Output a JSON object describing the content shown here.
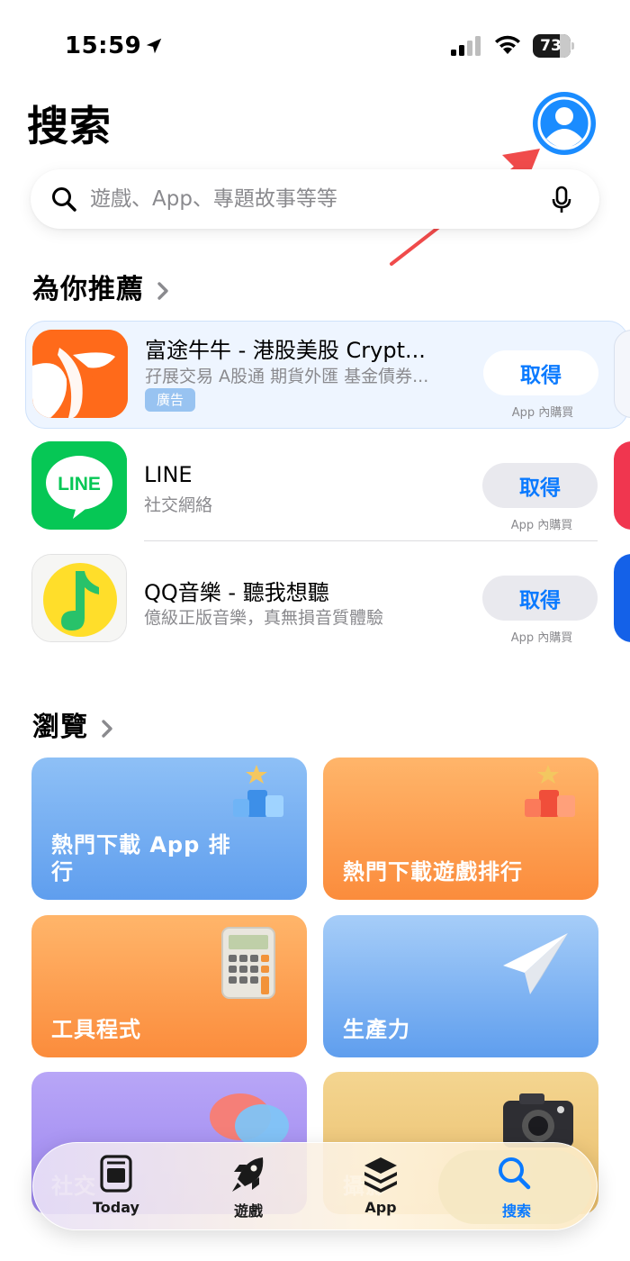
{
  "status_bar": {
    "time": "15:59",
    "battery": "73"
  },
  "header": {
    "title": "搜索"
  },
  "search": {
    "placeholder": "遊戲、App、專題故事等等"
  },
  "recommended": {
    "title": "為你推薦",
    "apps": [
      {
        "name": "富途牛牛 - 港股美股 Crypt...",
        "subtitle": "孖展交易 A股通 期貨外匯 基金債券...",
        "badge": "廣告",
        "button": "取得",
        "note": "App 內購買"
      },
      {
        "name": "LINE",
        "subtitle": "社交網絡",
        "button": "取得",
        "note": "App 內購買"
      },
      {
        "name": "QQ音樂 - 聽我想聽",
        "subtitle": "億級正版音樂，真無損音質體驗",
        "button": "取得",
        "note": "App 內購買"
      }
    ]
  },
  "browse": {
    "title": "瀏覽",
    "tiles": [
      {
        "label": "熱門下載 App 排行",
        "color": "#6aa9ee"
      },
      {
        "label": "熱門下載遊戲排行",
        "color": "#fb9545"
      },
      {
        "label": "工具程式",
        "color": "#fb9545"
      },
      {
        "label": "生產力",
        "color": "#6aa9ee"
      },
      {
        "label": "社交",
        "color": "#a58ff0"
      },
      {
        "label": "攝影",
        "color": "#ecc877"
      }
    ]
  },
  "tab_bar": {
    "tabs": [
      {
        "label": "Today",
        "icon": "today-icon"
      },
      {
        "label": "遊戲",
        "icon": "rocket-icon"
      },
      {
        "label": "App",
        "icon": "stack-icon"
      },
      {
        "label": "搜索",
        "icon": "search-icon",
        "active": true
      }
    ]
  },
  "colors": {
    "accent": "#0a7aff",
    "annotation_arrow": "#f04b4b"
  }
}
